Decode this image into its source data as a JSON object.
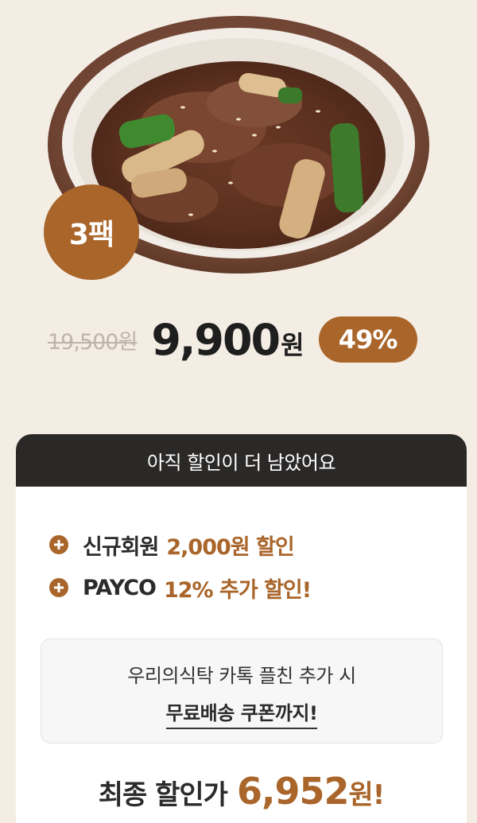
{
  "product": {
    "image_alt": "bulgogi bowl",
    "pack_badge": "3팩"
  },
  "price": {
    "original": "19,500원",
    "sale": "9,900",
    "sale_unit": "원",
    "discount": "49%"
  },
  "card": {
    "header": "아직 할인이 더 남았어요",
    "benefits": [
      {
        "icon": "plus-icon",
        "label": "신규회원",
        "highlight": "2,000원 할인"
      },
      {
        "icon": "plus-icon",
        "label": "PAYCO",
        "highlight": "12% 추가 할인!"
      }
    ],
    "kakao": {
      "line1": "우리의식탁 카톡 플친 추가 시",
      "line2": "무료배송 쿠폰까지!"
    },
    "final": {
      "label": "최종 할인가",
      "price": "6,952",
      "unit": "원!"
    }
  },
  "colors": {
    "background": "#f4ede4",
    "accent": "#a9652a",
    "header": "#2b2928"
  }
}
